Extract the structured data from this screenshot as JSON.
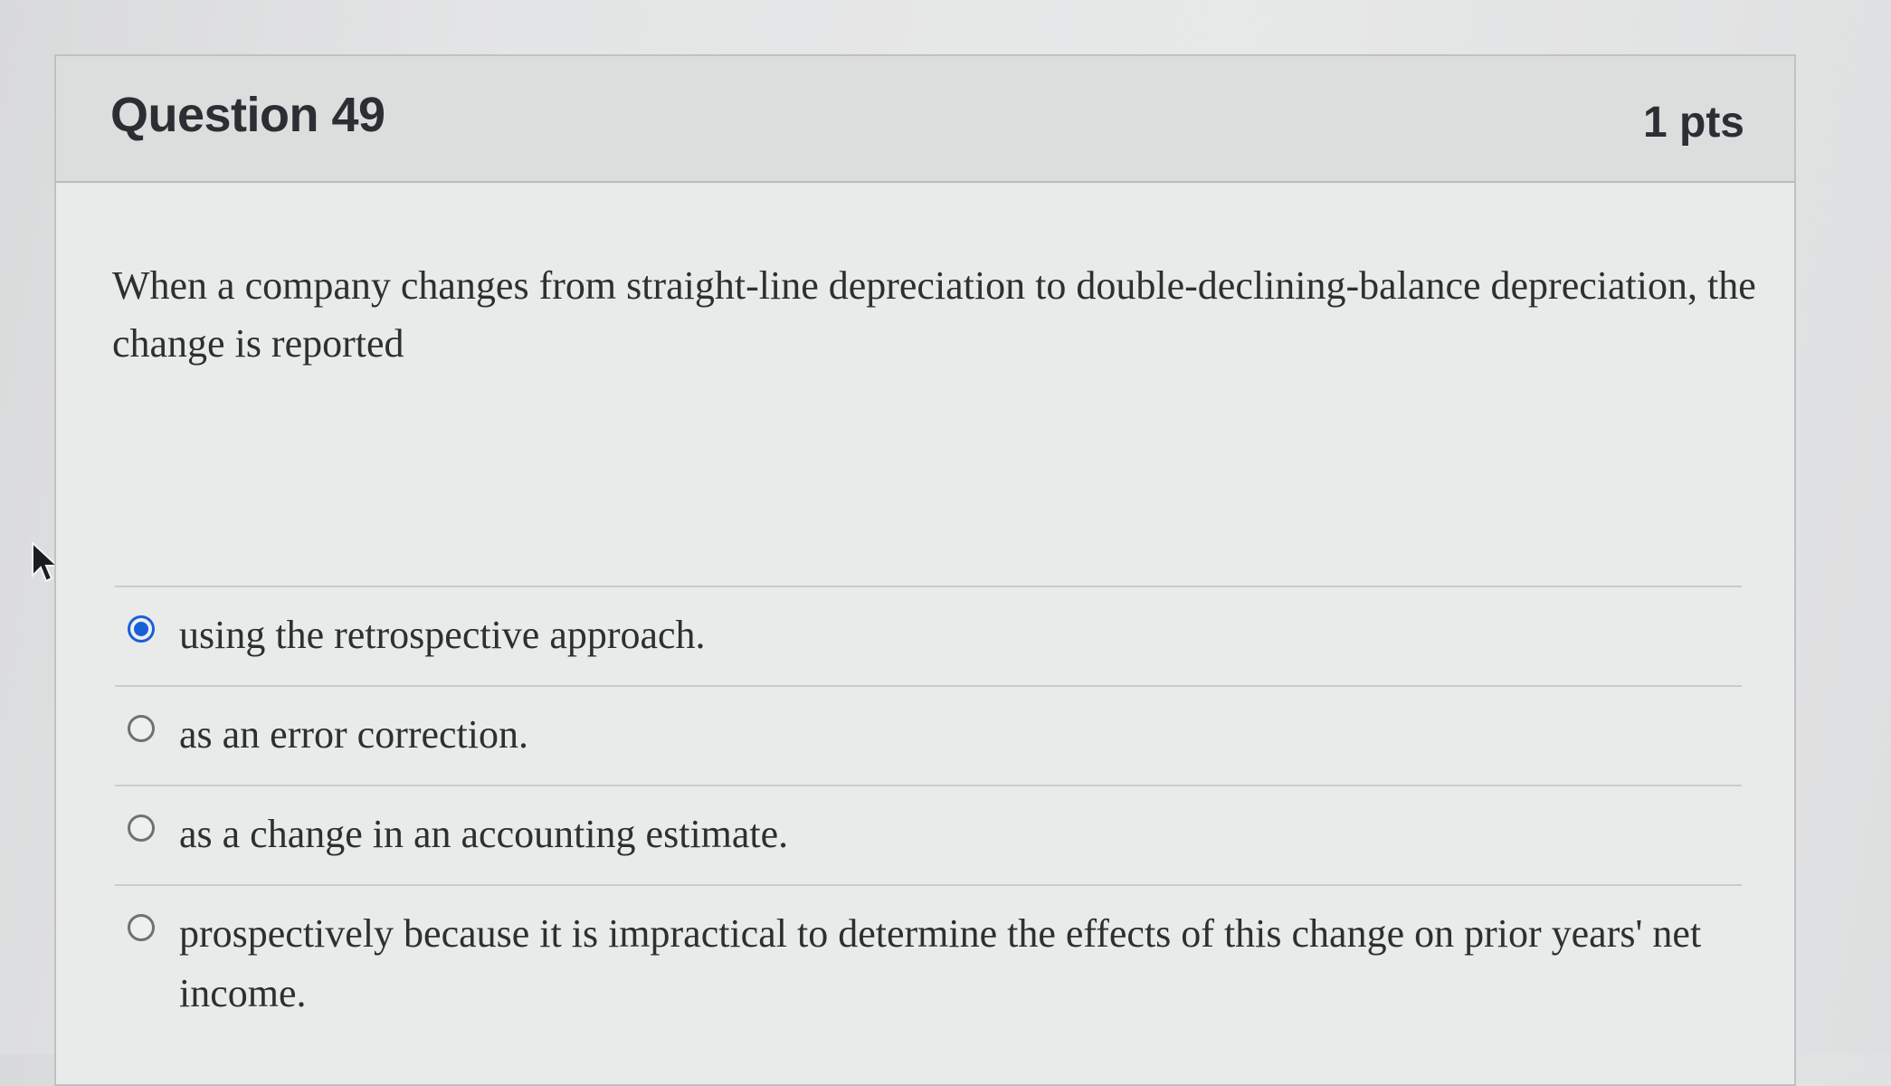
{
  "question": {
    "title": "Question 49",
    "points": "1 pts",
    "text": "When a company changes from straight-line depreciation to double-declining-balance depreciation, the change is reported"
  },
  "answers": [
    {
      "label": "using the retrospective approach.",
      "selected": true
    },
    {
      "label": "as an error correction.",
      "selected": false
    },
    {
      "label": "as a change in an accounting estimate.",
      "selected": false
    },
    {
      "label": "prospectively because it is impractical to determine the effects of this change on prior years' net income.",
      "selected": false
    }
  ],
  "colors": {
    "accent": "#1a5fd6",
    "text": "#2d2f31",
    "header_bg": "#dcdddd"
  },
  "icons": {
    "cursor": "mouse-pointer-icon"
  }
}
